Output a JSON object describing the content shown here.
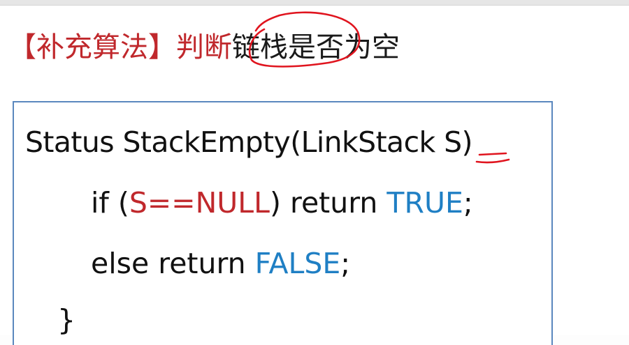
{
  "title": {
    "bracketed_prefix": "【补充算法】",
    "verb": "判断",
    "subject": "链栈是否为空"
  },
  "code": {
    "line1": "Status StackEmpty(LinkStack S)",
    "line2": {
      "kw_if": "if (",
      "condition": "S==NULL",
      "after_cond": ") return ",
      "value": "TRUE",
      "end": ";"
    },
    "line3": {
      "prefix": "else return ",
      "value": "FALSE",
      "end": ";"
    },
    "line4": "}"
  },
  "colors": {
    "title_red": "#c0282c",
    "code_blue": "#1f7fc4",
    "box_border": "#5a87be",
    "annotation_red": "#e0141e"
  }
}
